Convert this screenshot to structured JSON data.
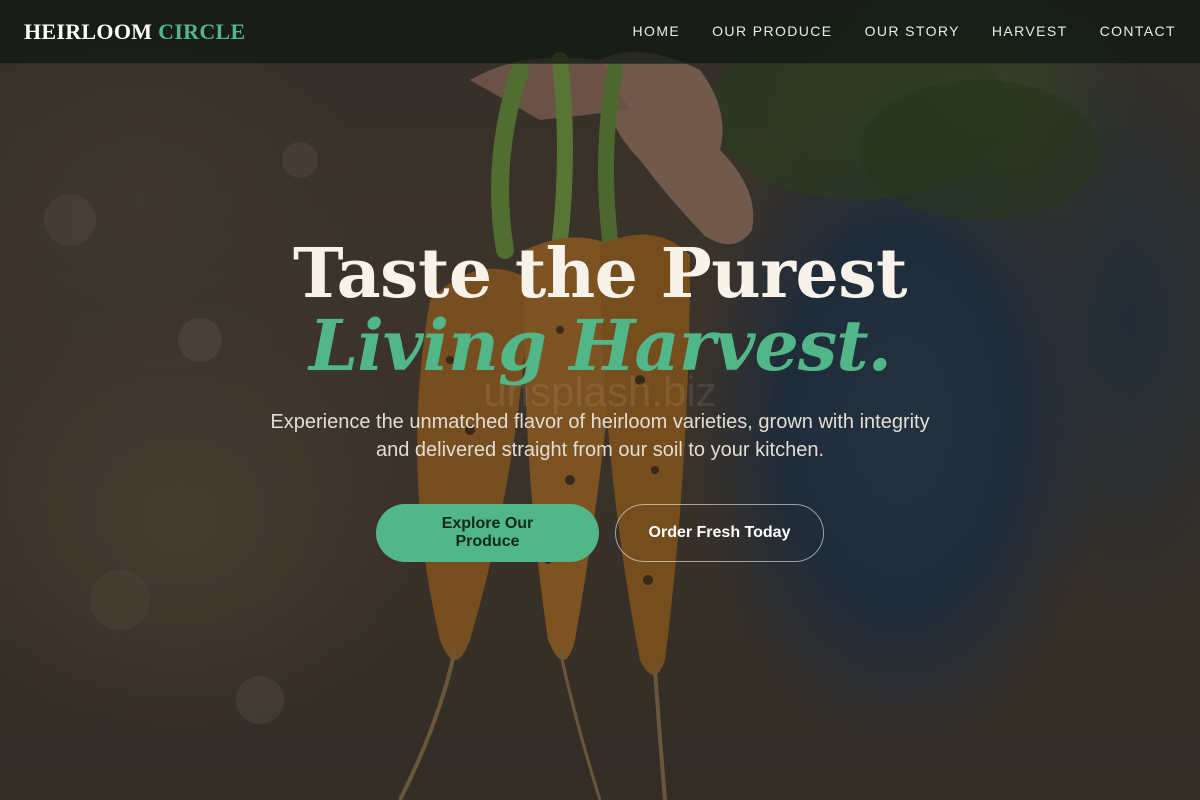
{
  "brand": {
    "name": "HEIRLOOM",
    "accent": "CIRCLE",
    "accent_color": "#52b788"
  },
  "nav": {
    "items": [
      {
        "label": "HOME"
      },
      {
        "label": "OUR PRODUCE"
      },
      {
        "label": "OUR STORY"
      },
      {
        "label": "HARVEST"
      },
      {
        "label": "CONTACT"
      }
    ]
  },
  "hero": {
    "headline": "Taste the Purest",
    "headline_accent": "Living Harvest.",
    "subtext": "Experience the unmatched flavor of heirloom varieties, grown with integrity and delivered straight from our soil to your kitchen.",
    "primary_cta": "Explore Our Produce",
    "secondary_cta": "Order Fresh Today",
    "watermark": "unsplash.biz"
  },
  "colors": {
    "primary_green": "#52b788",
    "cream_text": "#f7f3ea",
    "nav_background": "#0e1612"
  }
}
